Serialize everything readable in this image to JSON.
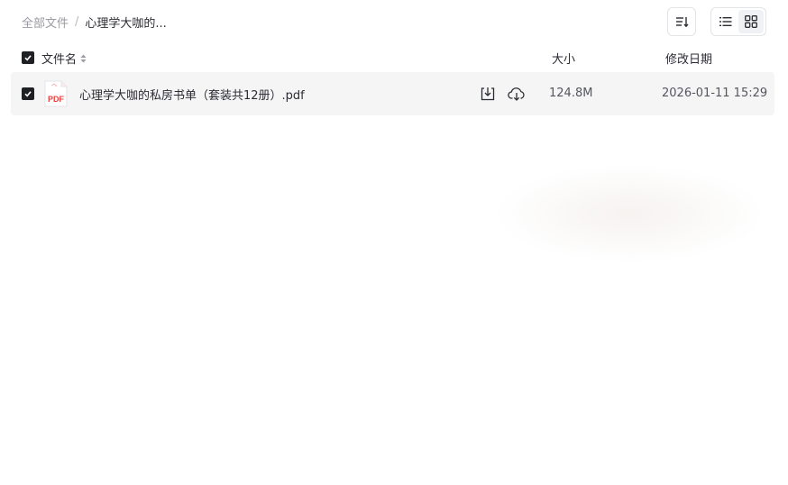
{
  "breadcrumb": {
    "root": "全部文件",
    "separator": "/",
    "current": "心理学大咖的..."
  },
  "toolbar": {
    "sort_icon": "sort-descending-icon",
    "view_list_icon": "list-view-icon",
    "view_grid_icon": "grid-view-icon",
    "selected_view": "list"
  },
  "table": {
    "columns": {
      "name": "文件名",
      "size": "大小",
      "modified": "修改日期"
    },
    "rows": [
      {
        "selected": true,
        "type_badge": "PDF",
        "name": "心理学大咖的私房书单（套装共12册）.pdf",
        "size": "124.8M",
        "modified": "2026-01-11 15:29"
      }
    ]
  },
  "colors": {
    "checkbox": "#1f2024",
    "row_bg": "#f5f5f6",
    "pdf_red": "#e8413e"
  }
}
